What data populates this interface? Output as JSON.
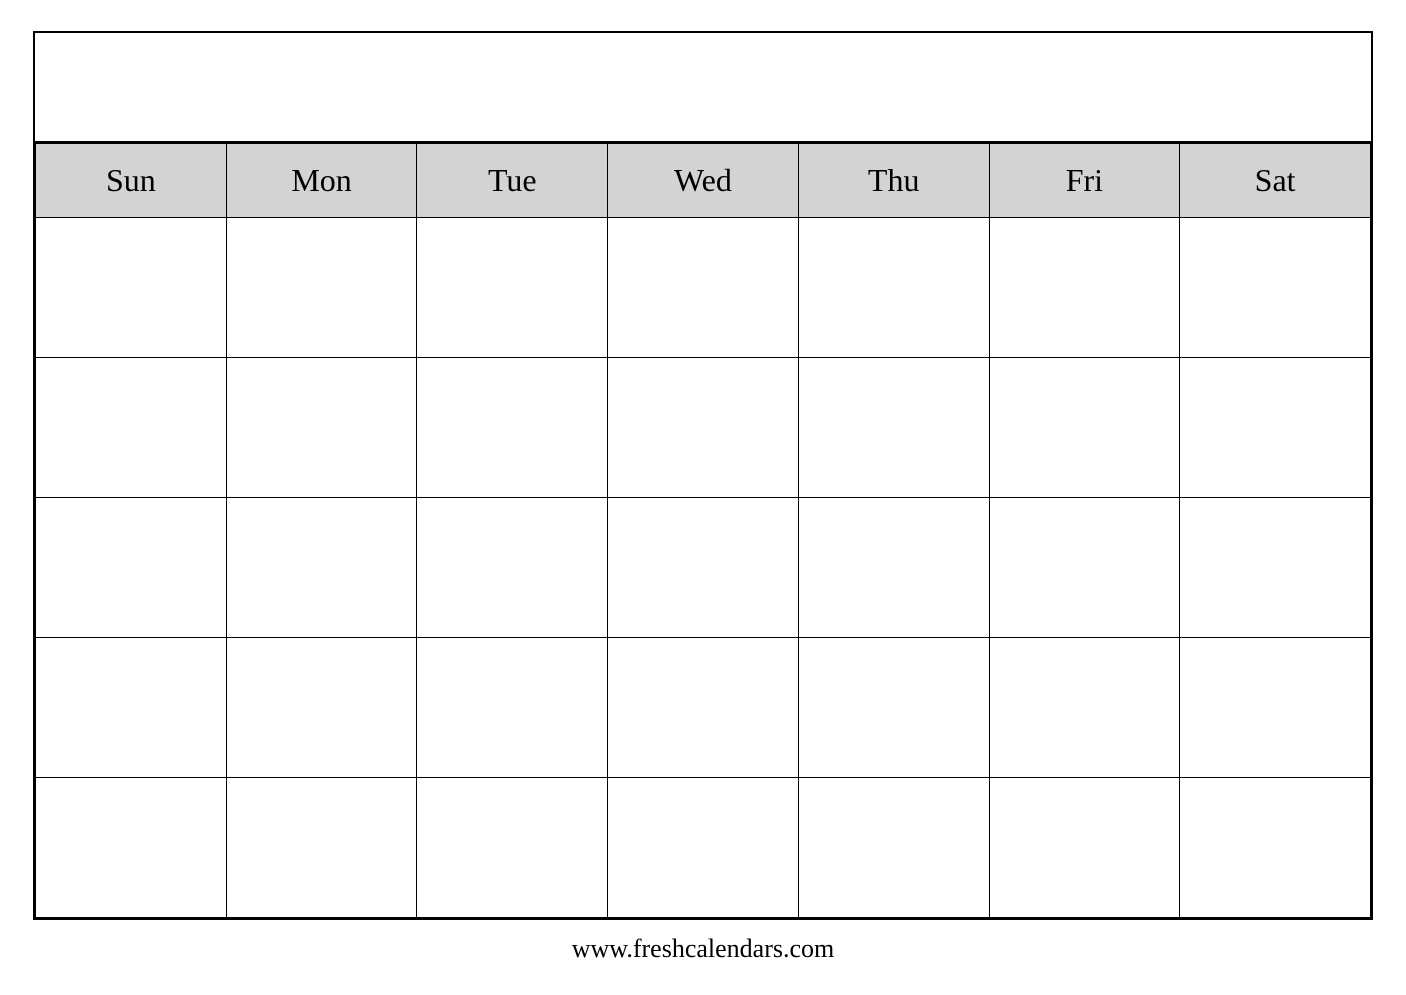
{
  "calendar": {
    "days": [
      "Sun",
      "Mon",
      "Tue",
      "Wed",
      "Thu",
      "Fri",
      "Sat"
    ],
    "rows": 5,
    "footer": "www.freshcalendars.com"
  }
}
